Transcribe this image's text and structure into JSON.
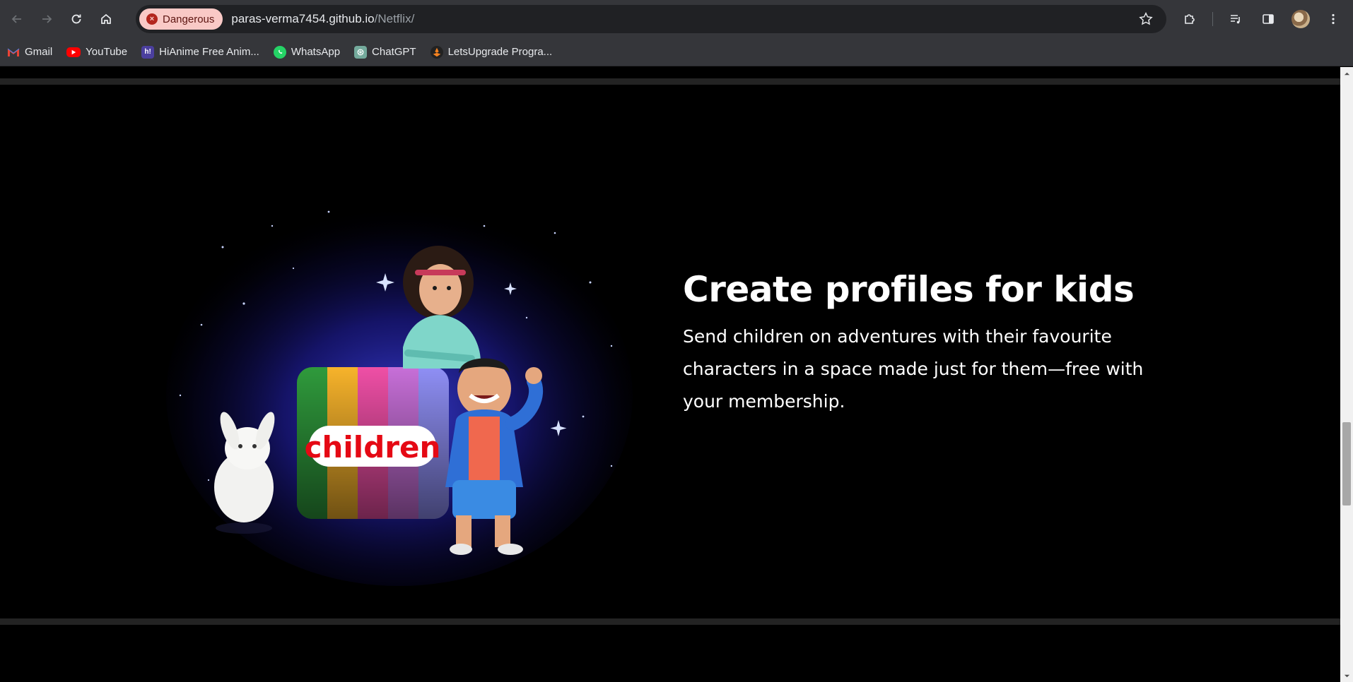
{
  "browser": {
    "security_chip": "Dangerous",
    "url_host": "paras-verma7454.github.io",
    "url_path": "/Netflix/",
    "bookmarks": [
      {
        "label": "Gmail",
        "icon": "gmail-icon",
        "color": "#ea4335"
      },
      {
        "label": "YouTube",
        "icon": "youtube-icon",
        "color": "#ff0000"
      },
      {
        "label": "HiAnime Free Anim...",
        "icon": "hianime-icon",
        "color": "#4b3f9e"
      },
      {
        "label": "WhatsApp",
        "icon": "whatsapp-icon",
        "color": "#25d366"
      },
      {
        "label": "ChatGPT",
        "icon": "chatgpt-icon",
        "color": "#74aa9c"
      },
      {
        "label": "LetsUpgrade Progra...",
        "icon": "letsupgrade-icon",
        "color": "#f58220"
      }
    ]
  },
  "page": {
    "headline": "Create profiles for kids",
    "subtext": "Send children on adventures with their favourite characters in a space made just for them—free with your membership.",
    "art_label": "children",
    "colors": {
      "background": "#000000",
      "divider": "#232323",
      "text": "#ffffff"
    }
  }
}
